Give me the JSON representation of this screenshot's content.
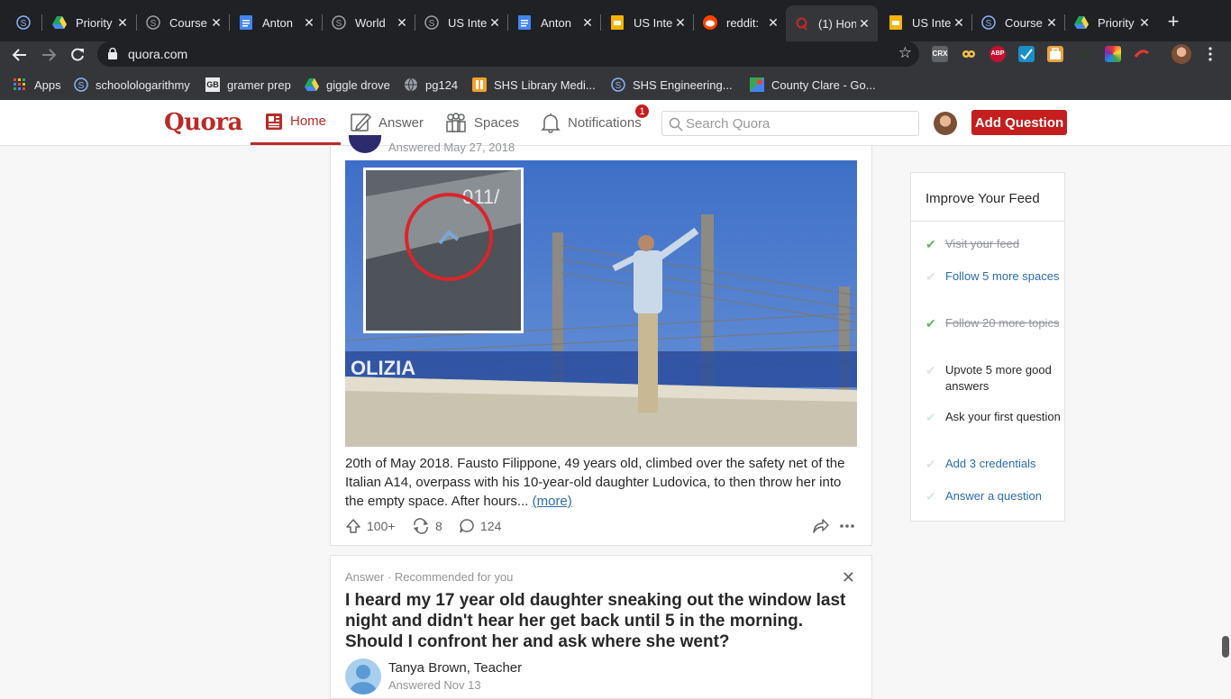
{
  "browser": {
    "tabs": [
      {
        "label": "",
        "icon": "socratic-icon",
        "pinned": true
      },
      {
        "label": "Priority",
        "icon": "google-drive-icon"
      },
      {
        "label": "Course",
        "icon": "socratic-icon"
      },
      {
        "label": "Anton",
        "icon": "google-docs-icon"
      },
      {
        "label": "World",
        "icon": "socratic-icon"
      },
      {
        "label": "US Inte",
        "icon": "socratic-icon"
      },
      {
        "label": "Anton",
        "icon": "google-docs-icon"
      },
      {
        "label": "US Inte",
        "icon": "google-slides-icon"
      },
      {
        "label": "reddit:",
        "icon": "reddit-icon"
      },
      {
        "label": "(1) Hon",
        "icon": "quora-icon",
        "active": true
      },
      {
        "label": "US Inte",
        "icon": "google-slides-icon"
      },
      {
        "label": "Course",
        "icon": "socratic-icon"
      },
      {
        "label": "Priority",
        "icon": "google-drive-icon"
      }
    ],
    "new_tab_label": "+",
    "url": "quora.com",
    "extensions": [
      "CRX",
      "",
      "ABP",
      "",
      "",
      "",
      "",
      ""
    ],
    "bookmarks": [
      {
        "label": "Apps",
        "icon": "apps-grid-icon"
      },
      {
        "label": "schoolologarithmy",
        "icon": "socratic-icon"
      },
      {
        "label": "gramer prep",
        "icon": "grammar-icon"
      },
      {
        "label": "giggle drove",
        "icon": "google-drive-icon"
      },
      {
        "label": "pg124",
        "icon": "globe-icon"
      },
      {
        "label": "SHS Library Medi...",
        "icon": "library-icon"
      },
      {
        "label": "SHS Engineering...",
        "icon": "socratic-icon"
      },
      {
        "label": "County Clare - Go...",
        "icon": "maps-icon"
      }
    ]
  },
  "quora": {
    "logo": "Quora",
    "nav": {
      "home": "Home",
      "answer": "Answer",
      "spaces": "Spaces",
      "notifications": "Notifications",
      "notifications_count": "1"
    },
    "search_placeholder": "Search Quora",
    "add_question": "Add Question",
    "accent": "#b92b27"
  },
  "feed": {
    "card1": {
      "answered_date": "Answered May 27, 2018",
      "image_overlay_text": "011/",
      "image_sign_text": "OLIZIA",
      "text": "20th of May 2018. Fausto Filippone, 49 years old, climbed over the safety net of the Italian A14, overpass with his 10-year-old daughter Ludovica, to then throw her into the empty space. After hours... ",
      "more": "(more)",
      "upvotes": "100+",
      "shares": "8",
      "comments": "124"
    },
    "card2": {
      "label": "Answer · Recommended for you",
      "question": "I heard my 17 year old daughter sneaking out the window last night and didn't hear her get back until 5 in the morning. Should I confront her and ask where she went?",
      "author": "Tanya Brown, Teacher",
      "answered_date": "Answered Nov 13"
    }
  },
  "sidebar": {
    "title": "Improve Your Feed",
    "tasks": [
      {
        "label": "Visit your feed",
        "state": "done"
      },
      {
        "label": "Follow 5 more spaces",
        "state": "link"
      },
      {
        "label": "Follow 20 more topics",
        "state": "done"
      },
      {
        "label": "Upvote 5 more good answers",
        "state": "plain"
      },
      {
        "label": "Ask your first question",
        "state": "plain"
      },
      {
        "label": "Add 3 credentials",
        "state": "link"
      },
      {
        "label": "Answer a question",
        "state": "link"
      }
    ]
  }
}
